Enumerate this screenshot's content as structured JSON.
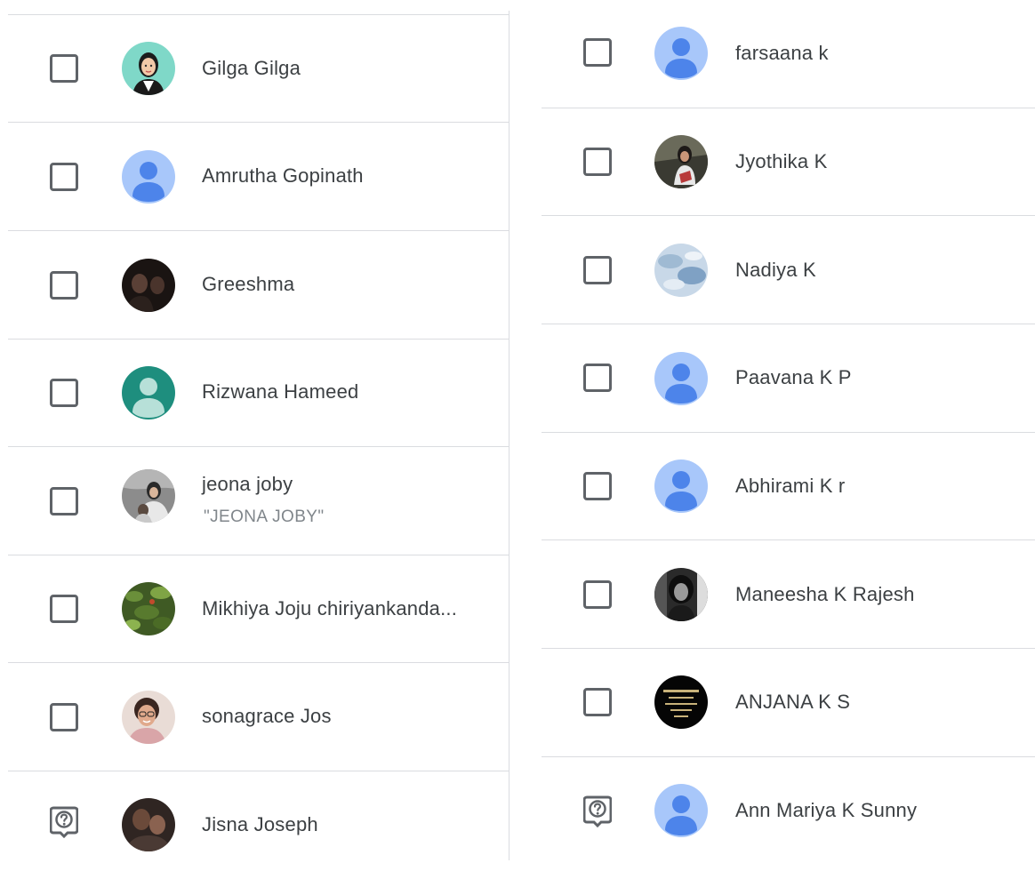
{
  "left_column": {
    "members": [
      {
        "name": "Gilga Gilga",
        "nickname": "",
        "avatar": "cartoon-photo",
        "status": "checkbox"
      },
      {
        "name": "Amrutha Gopinath",
        "nickname": "",
        "avatar": "default-blue-person",
        "status": "checkbox"
      },
      {
        "name": "Greeshma",
        "nickname": "",
        "avatar": "dark-photo",
        "status": "checkbox"
      },
      {
        "name": "Rizwana Hameed",
        "nickname": "",
        "avatar": "teal-person",
        "status": "checkbox"
      },
      {
        "name": "jeona joby",
        "nickname": "\"JEONA JOBY\"",
        "avatar": "photo",
        "status": "checkbox"
      },
      {
        "name": "Mikhiya Joju chiriyankanda...",
        "nickname": "",
        "avatar": "green-leaves-photo",
        "status": "checkbox"
      },
      {
        "name": "sonagrace Jos",
        "nickname": "",
        "avatar": "selfie-photo",
        "status": "checkbox"
      },
      {
        "name": "Jisna Joseph",
        "nickname": "",
        "avatar": "dark-photo",
        "status": "question"
      }
    ]
  },
  "right_column": {
    "members": [
      {
        "name": "farsaana k",
        "avatar": "default-blue-person",
        "status": "checkbox"
      },
      {
        "name": "Jyothika K",
        "avatar": "photo",
        "status": "checkbox"
      },
      {
        "name": "Nadiya K",
        "avatar": "blue-sky-photo",
        "status": "checkbox"
      },
      {
        "name": "Paavana K P",
        "avatar": "default-blue-person",
        "status": "checkbox"
      },
      {
        "name": "Abhirami K r",
        "avatar": "default-blue-person",
        "status": "checkbox"
      },
      {
        "name": "Maneesha K Rajesh",
        "avatar": "black-white-photo",
        "status": "checkbox"
      },
      {
        "name": "ANJANA K S",
        "avatar": "black-text-photo",
        "status": "checkbox"
      },
      {
        "name": "Ann Mariya K Sunny",
        "avatar": "default-blue-person",
        "status": "question"
      }
    ]
  },
  "colors": {
    "default_avatar_bg": "#a8c7fa",
    "default_avatar_fg": "#4d84ea",
    "teal_avatar_bg": "#1e8e7e",
    "checkbox_border": "#5f6368",
    "divider": "#dadce0",
    "text": "#3c4043",
    "nickname_text": "#80868b"
  }
}
